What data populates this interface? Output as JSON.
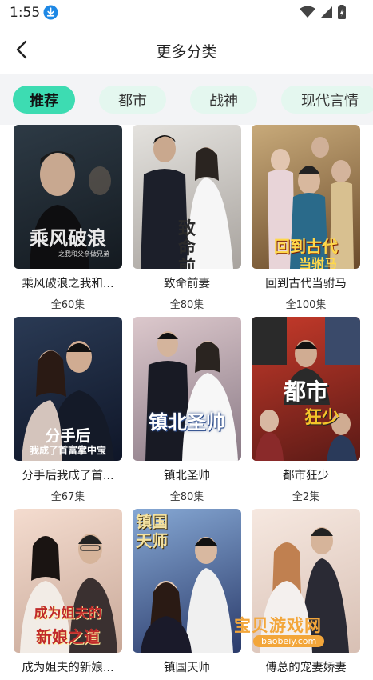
{
  "status": {
    "time": "1:55"
  },
  "header": {
    "title": "更多分类",
    "back_icon": "chevron-left-icon"
  },
  "tabs": [
    {
      "label": "推荐",
      "active": true
    },
    {
      "label": "都市",
      "active": false
    },
    {
      "label": "战神",
      "active": false
    },
    {
      "label": "现代言情",
      "active": false
    }
  ],
  "items": [
    {
      "title": "乘风破浪之我和...",
      "count": "全60集",
      "poster_text": "乘风破浪",
      "poster_sub": "之我和父亲做兄弟",
      "bg1": "#2d3a45",
      "bg2": "#141a20",
      "text_color": "#e9e9e9"
    },
    {
      "title": "致命前妻",
      "count": "全80集",
      "poster_text": "致命前妻",
      "poster_sub": "",
      "bg1": "#d9d6d0",
      "bg2": "#9a9590",
      "text_color": "#2a2a2a"
    },
    {
      "title": "回到古代当驸马",
      "count": "全100集",
      "poster_text": "回到古代",
      "poster_sub": "当驸马",
      "bg1": "#b99a6a",
      "bg2": "#6a4a2a",
      "text_color": "#ffd84a"
    },
    {
      "title": "分手后我成了首...",
      "count": "全67集",
      "poster_text": "分手后",
      "poster_sub": "我成了首富掌中宝",
      "bg1": "#24324a",
      "bg2": "#0f1628",
      "text_color": "#ffffff"
    },
    {
      "title": "镇北圣帅",
      "count": "全80集",
      "poster_text": "镇北圣帅",
      "poster_sub": "",
      "bg1": "#d8c4c8",
      "bg2": "#8a7a86",
      "text_color": "#ffffff"
    },
    {
      "title": "都市狂少",
      "count": "全2集",
      "poster_text": "都市",
      "poster_sub": "狂少",
      "bg1": "#c63a2a",
      "bg2": "#5a1a16",
      "text_color": "#ffffff"
    },
    {
      "title": "成为姐夫的新娘...",
      "count": "",
      "poster_text": "成为姐夫的",
      "poster_sub": "新娘之道",
      "bg1": "#f2d8cc",
      "bg2": "#c8a898",
      "text_color": "#c02a2a"
    },
    {
      "title": "镇国天师",
      "count": "",
      "poster_text": "镇国天师",
      "poster_sub": "",
      "bg1": "#7a9ac8",
      "bg2": "#2a3a6a",
      "text_color": "#f4e2a0"
    },
    {
      "title": "傅总的宠妻娇妻",
      "count": "",
      "poster_text": "",
      "poster_sub": "",
      "bg1": "#f4e6de",
      "bg2": "#d8c0b4",
      "text_color": "#c02a2a"
    }
  ],
  "watermark": {
    "text": "宝贝游戏网",
    "url": "baobeiy.com"
  }
}
